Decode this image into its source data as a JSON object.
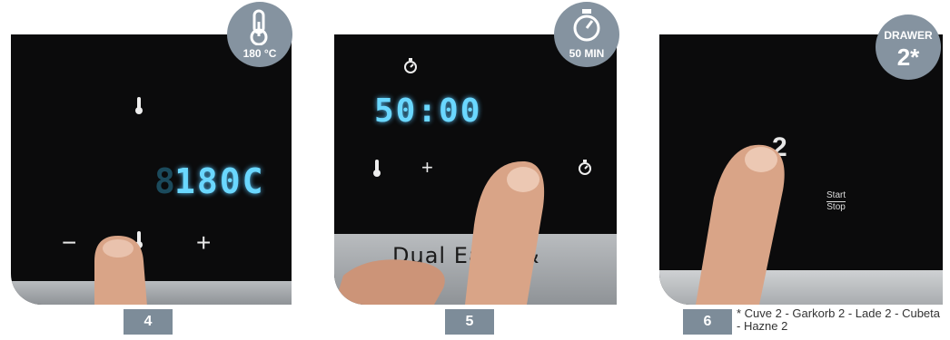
{
  "steps": [
    {
      "number": "4",
      "badge": {
        "icon": "thermometer-icon",
        "label": "180 °C"
      },
      "display": "180C"
    },
    {
      "number": "5",
      "badge": {
        "icon": "timer-icon",
        "label": "50 MIN"
      },
      "display": "50:00",
      "strip_text": "Dual Ea   ry &"
    },
    {
      "number": "6",
      "badge": {
        "label": "DRAWER",
        "value": "2*"
      },
      "display": "2",
      "start_label": "Start",
      "stop_label": "Stop"
    }
  ],
  "controls": {
    "minus": "−",
    "plus": "+"
  },
  "footnote": "* Cuve 2 - Garkorb 2 - Lade 2 - Cubeta  - Hazne 2",
  "colors": {
    "badge": "#8593a0",
    "step": "#7d8c99",
    "lcd": "#6ad7ff"
  }
}
